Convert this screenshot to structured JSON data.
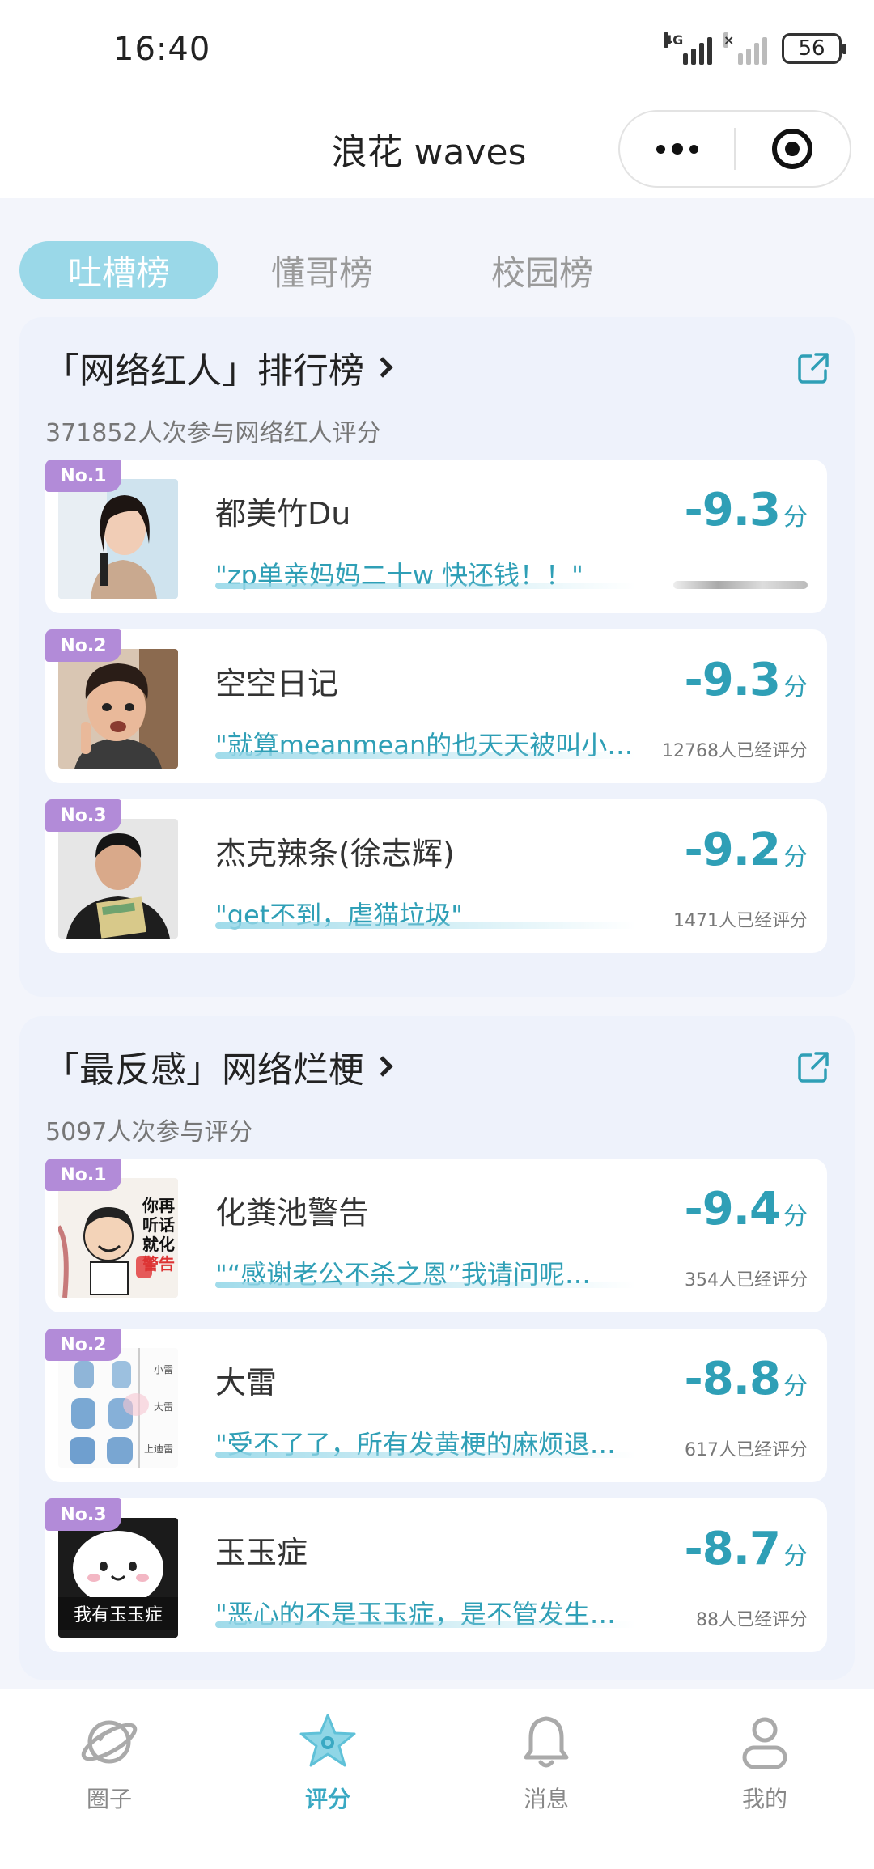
{
  "status_bar": {
    "time": "16:40",
    "network": "4G",
    "battery": "56"
  },
  "title_bar": {
    "title": "浪花 waves"
  },
  "tabs": [
    {
      "label": "吐槽榜",
      "active": true
    },
    {
      "label": "懂哥榜",
      "active": false
    },
    {
      "label": "校园榜",
      "active": false
    }
  ],
  "sections": [
    {
      "title": "「网络红人」排行榜",
      "subtitle": "371852人次参与网络红人评分",
      "items": [
        {
          "rank": "No.1",
          "name": "都美竹Du",
          "comment": "\"zp单亲妈妈二十w 快还钱！！\"",
          "score": "-9.3",
          "unit": "分",
          "count": ""
        },
        {
          "rank": "No.2",
          "name": "空空日记",
          "comment": "\"就算meanmean的也天天被叫小…",
          "score": "-9.3",
          "unit": "分",
          "count": "12768人已经评分"
        },
        {
          "rank": "No.3",
          "name": "杰克辣条(徐志辉)",
          "comment": "\"get不到，虐猫垃圾\"",
          "score": "-9.2",
          "unit": "分",
          "count": "1471人已经评分"
        }
      ]
    },
    {
      "title": "「最反感」网络烂梗",
      "subtitle": "5097人次参与评分",
      "items": [
        {
          "rank": "No.1",
          "name": "化粪池警告",
          "comment": "\"“感谢老公不杀之恩”我请问呢…",
          "score": "-9.4",
          "unit": "分",
          "count": "354人已经评分",
          "thumb_text": [
            "你再",
            "听话",
            "就化",
            "警告"
          ]
        },
        {
          "rank": "No.2",
          "name": "大雷",
          "comment": "\"受不了了，所有发黄梗的麻烦退…",
          "score": "-8.8",
          "unit": "分",
          "count": "617人已经评分",
          "thumb_text": [
            "小雷",
            "大雷",
            "上迪雷"
          ]
        },
        {
          "rank": "No.3",
          "name": "玉玉症",
          "comment": "\"恶心的不是玉玉症，是不管发生…",
          "score": "-8.7",
          "unit": "分",
          "count": "88人已经评分",
          "thumb_text": [
            "我有玉玉症"
          ]
        }
      ]
    }
  ],
  "bottom_nav": [
    {
      "label": "圈子",
      "icon": "planet-icon",
      "active": false
    },
    {
      "label": "评分",
      "icon": "star-icon",
      "active": true
    },
    {
      "label": "消息",
      "icon": "bell-icon",
      "active": false
    },
    {
      "label": "我的",
      "icon": "user-icon",
      "active": false
    }
  ],
  "colors": {
    "accent": "#2f9fb6",
    "tab_active": "#9ad8e8",
    "badge": "#b28bd8",
    "section_bg": "#eef2fb"
  }
}
